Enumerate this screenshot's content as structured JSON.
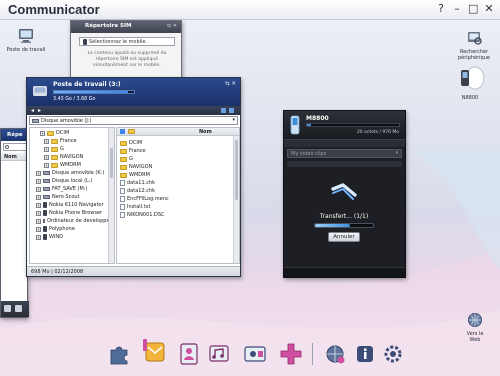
{
  "app": {
    "title": "Communicator",
    "window_controls": [
      "?",
      "–",
      "□",
      "✕"
    ]
  },
  "desktop": {
    "poste_label": "Poste de travail",
    "rechercher_label": "Rechercher\npériphérique",
    "n_label": "N8800",
    "web_label": "Vers le\nWeb"
  },
  "sim_window": {
    "title": "Répertoire SIM",
    "select_value": "Sélectionnez le mobile.",
    "message": "Le contenu ajouté ou supprimé du répertoire SIM est appliqué simultanément sur le mobile."
  },
  "left_panel": {
    "title": "Répe",
    "header_text": "Nom"
  },
  "explorer": {
    "title": "Poste de travail (3:)",
    "storage": "3.43 Go / 3.68 Go",
    "storage_fill": 0.93,
    "drive_select": "Disque amovible (J:)",
    "tree": [
      {
        "label": "DCIM",
        "type": "folder",
        "indent": 2
      },
      {
        "label": "France",
        "type": "folder",
        "indent": 3
      },
      {
        "label": "G",
        "type": "folder",
        "indent": 3
      },
      {
        "label": "NAVIGON",
        "type": "folder",
        "indent": 3
      },
      {
        "label": "WMDRM",
        "type": "folder",
        "indent": 3
      },
      {
        "label": "Disque amovible (K:)",
        "type": "drive",
        "indent": 1
      },
      {
        "label": "Disque local (L:)",
        "type": "drive",
        "indent": 1
      },
      {
        "label": "FAT_SAVE (M:)",
        "type": "drive",
        "indent": 1
      },
      {
        "label": "Nero Scout",
        "type": "drive",
        "indent": 1
      },
      {
        "label": "Nokia 6110 Navigator",
        "type": "phone",
        "indent": 1
      },
      {
        "label": "Nokia Phone Browser",
        "type": "phone",
        "indent": 1
      },
      {
        "label": "Ordinateur de developpement",
        "type": "drive",
        "indent": 1
      },
      {
        "label": "Polyphone",
        "type": "phone",
        "indent": 1
      },
      {
        "label": "WIND",
        "type": "phone",
        "indent": 1
      }
    ],
    "list_header": "Nom",
    "files": [
      {
        "label": "DCIM",
        "type": "folder"
      },
      {
        "label": "France",
        "type": "folder"
      },
      {
        "label": "G",
        "type": "folder"
      },
      {
        "label": "NAVIGON",
        "type": "folder"
      },
      {
        "label": "WMDRM",
        "type": "folder"
      },
      {
        "label": "data11.chk",
        "type": "file"
      },
      {
        "label": "data12.chk",
        "type": "file"
      },
      {
        "label": "EncFFilLog.menc",
        "type": "file"
      },
      {
        "label": "Install.txt",
        "type": "file"
      },
      {
        "label": "NIKON001.DSC",
        "type": "file"
      }
    ],
    "status": "698 Mo | 02/12/2008"
  },
  "device_panel": {
    "title": "M8800",
    "storage": "20 octets / 970 Mo",
    "search_placeholder": "My video clips",
    "transfer_label": "Transfert... (1/1)",
    "transfer_progress": 0.6,
    "cancel_label": "Annuler"
  },
  "dock": {
    "items": [
      "puzzle",
      "messages",
      "phonebook",
      "media",
      "camera-card",
      "add",
      "web",
      "info",
      "settings"
    ]
  },
  "colors": {
    "accent": "#3b8fd8",
    "titlebar": "#1f3f86",
    "dark_panel": "#1b1d22",
    "dock_pink": "#d14fa0"
  }
}
